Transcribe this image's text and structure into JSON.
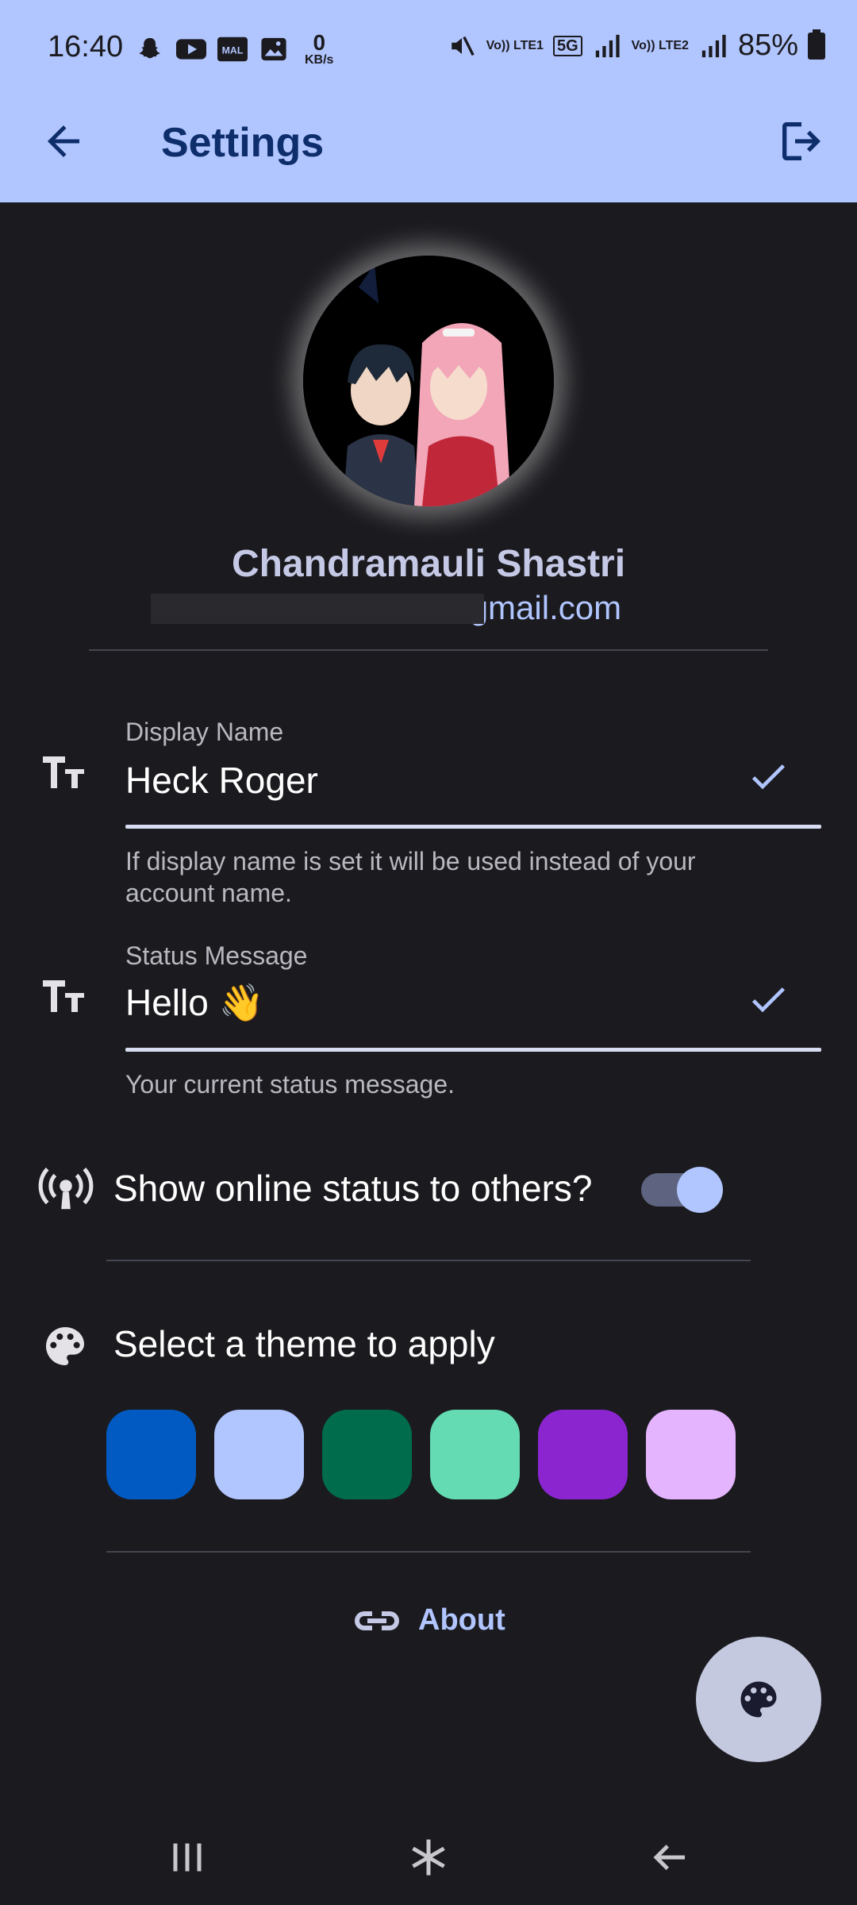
{
  "status_bar": {
    "time": "16:40",
    "net_speed_value": "0",
    "net_speed_unit": "KB/s",
    "sim1_label": "Vo)) LTE1",
    "net_type": "5G",
    "sim2_label": "Vo)) LTE2",
    "battery": "85%"
  },
  "app_bar": {
    "title": "Settings"
  },
  "profile": {
    "name": "Chandramauli Shastri",
    "email": "@gmail.com"
  },
  "display_name": {
    "label": "Display Name",
    "value": "Heck Roger",
    "help": "If display name is set it will be used instead of your account name."
  },
  "status_message": {
    "label": "Status Message",
    "value": "Hello 👋",
    "help": "Your current status message."
  },
  "online_status": {
    "label": "Show online status to others?",
    "enabled": true
  },
  "theme": {
    "label": "Select a theme to apply",
    "swatches": [
      "#005ac1",
      "#b1c5ff",
      "#006c4c",
      "#64dbb2",
      "#8a25d0",
      "#e5b4ff"
    ]
  },
  "about": {
    "label": "About"
  },
  "colors": {
    "accent": "#b1c5ff",
    "background": "#1b1b1f"
  }
}
